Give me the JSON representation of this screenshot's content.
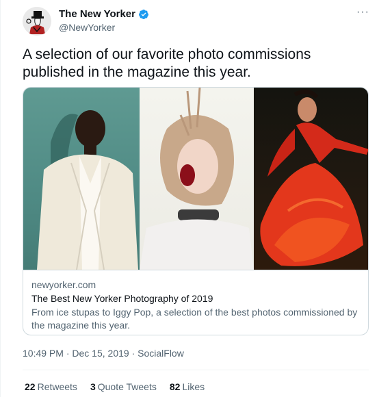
{
  "account": {
    "display_name": "The New Yorker",
    "handle": "@NewYorker",
    "verified_icon": "verified-badge-icon",
    "verified_color": "#1d9bf0"
  },
  "tweet": {
    "text": "A selection of our favorite photo commissions published in the magazine this year.",
    "more_icon": "more-icon",
    "more_label": "···"
  },
  "card": {
    "domain": "newyorker.com",
    "title": "The Best New Yorker Photography of 2019",
    "description": "From ice stupas to Iggy Pop, a selection of the best photos commissioned by the magazine this year."
  },
  "meta": {
    "time": "10:49 PM",
    "sep1": " · ",
    "date": "Dec 15, 2019",
    "sep2": " · ",
    "source": "SocialFlow"
  },
  "stats": {
    "retweets_count": "22",
    "retweets_label": "Retweets",
    "quotes_count": "3",
    "quotes_label": "Quote Tweets",
    "likes_count": "82",
    "likes_label": "Likes"
  }
}
